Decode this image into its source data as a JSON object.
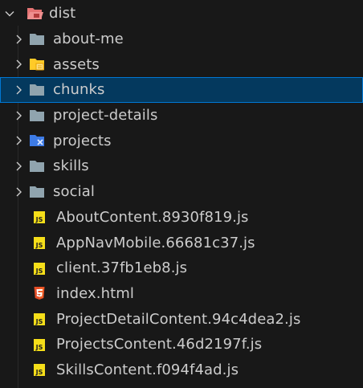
{
  "explorer": {
    "root": {
      "label": "dist",
      "icon": "folder-dist-open-icon"
    },
    "folders": [
      {
        "label": "about-me",
        "icon": "folder-icon"
      },
      {
        "label": "assets",
        "icon": "folder-assets-icon"
      },
      {
        "label": "chunks",
        "icon": "folder-icon",
        "selected": true
      },
      {
        "label": "project-details",
        "icon": "folder-icon"
      },
      {
        "label": "projects",
        "icon": "folder-projects-icon"
      },
      {
        "label": "skills",
        "icon": "folder-icon"
      },
      {
        "label": "social",
        "icon": "folder-icon"
      }
    ],
    "files": [
      {
        "label": "AboutContent.8930f819.js",
        "icon": "js-file-icon"
      },
      {
        "label": "AppNavMobile.66681c37.js",
        "icon": "js-file-icon"
      },
      {
        "label": "client.37fb1eb8.js",
        "icon": "js-file-icon"
      },
      {
        "label": "index.html",
        "icon": "html-file-icon"
      },
      {
        "label": "ProjectDetailContent.94c4dea2.js",
        "icon": "js-file-icon"
      },
      {
        "label": "ProjectsContent.46d2197f.js",
        "icon": "js-file-icon"
      },
      {
        "label": "SkillsContent.f094f4ad.js",
        "icon": "js-file-icon"
      }
    ]
  },
  "colors": {
    "background": "#181818",
    "text": "#cccccc",
    "selection": "#04395e",
    "selection_border": "#0078d4",
    "folder": "#90a4ae",
    "folder_dist": "#e57373",
    "folder_assets": "#ffca28",
    "folder_projects": "#3d7be6",
    "js_badge": "#f5de19",
    "html_badge": "#e44d26"
  }
}
